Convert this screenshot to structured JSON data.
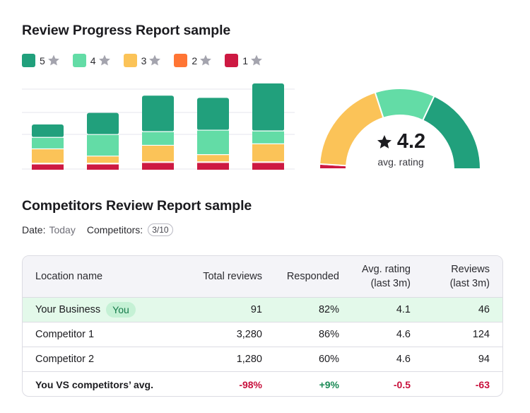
{
  "progress_report": {
    "title": "Review Progress Report sample",
    "legend": [
      {
        "label": "5",
        "color": "#21a07c"
      },
      {
        "label": "4",
        "color": "#63dca6"
      },
      {
        "label": "3",
        "color": "#fbc358"
      },
      {
        "label": "2",
        "color": "#ff7534"
      },
      {
        "label": "1",
        "color": "#cd1942"
      }
    ],
    "gauge": {
      "value": "4.2",
      "label": "avg. rating",
      "segments": [
        {
          "rating": "1",
          "share": 0.02,
          "color": "#cd1942"
        },
        {
          "rating": "3",
          "share": 0.38,
          "color": "#fbc358"
        },
        {
          "rating": "4",
          "share": 0.24,
          "color": "#63dca6"
        },
        {
          "rating": "5",
          "share": 0.36,
          "color": "#21a07c"
        }
      ]
    }
  },
  "chart_data": {
    "type": "bar",
    "stacked": true,
    "categories": [
      "",
      "",
      "",
      "",
      ""
    ],
    "ylim": [
      0,
      120
    ],
    "grid": true,
    "series": [
      {
        "name": "1",
        "color": "#cd1942",
        "values": [
          8,
          8,
          10,
          10,
          10
        ]
      },
      {
        "name": "2",
        "color": "#ff7534",
        "values": [
          1,
          1,
          1,
          1,
          1
        ]
      },
      {
        "name": "3",
        "color": "#fbc358",
        "values": [
          20,
          10,
          23,
          10,
          25
        ]
      },
      {
        "name": "4",
        "color": "#63dca6",
        "values": [
          16,
          30,
          19,
          34,
          18
        ]
      },
      {
        "name": "5",
        "color": "#21a07c",
        "values": [
          18,
          30,
          50,
          45,
          66
        ]
      }
    ]
  },
  "competitors_report": {
    "title": "Competitors Review Report sample",
    "date_label": "Date:",
    "date_value": "Today",
    "competitors_label": "Competitors:",
    "competitors_value": "3/10",
    "columns": {
      "location": "Location name",
      "total": "Total reviews",
      "responded": "Responded",
      "avg_line1": "Avg. rating",
      "avg_line2": "(last 3m)",
      "reviews_line1": "Reviews",
      "reviews_line2": "(last 3m)"
    },
    "rows": [
      {
        "name": "Your Business",
        "badge": "You",
        "total": "91",
        "responded": "82%",
        "avg": "4.1",
        "reviews": "46"
      },
      {
        "name": "Competitor 1",
        "total": "3,280",
        "responded": "86%",
        "avg": "4.6",
        "reviews": "124"
      },
      {
        "name": "Competitor 2",
        "total": "1,280",
        "responded": "60%",
        "avg": "4.6",
        "reviews": "94"
      }
    ],
    "summary": {
      "name": "You VS competitors’ avg.",
      "total": "-98%",
      "responded": "+9%",
      "avg": "-0.5",
      "reviews": "-63"
    }
  }
}
